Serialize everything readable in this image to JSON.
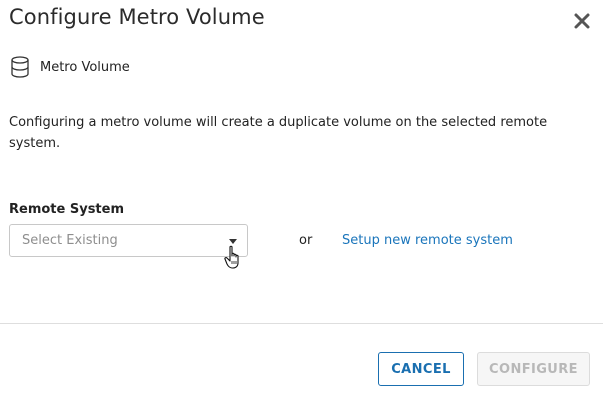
{
  "dialog": {
    "title": "Configure Metro Volume",
    "close_icon": "close-icon"
  },
  "volume": {
    "icon": "database-icon",
    "label": "Metro Volume"
  },
  "description": "Configuring a metro volume will create a duplicate volume on the selected remote system.",
  "remote_system": {
    "label": "Remote System",
    "select_placeholder": "Select Existing",
    "or_text": "or",
    "setup_link": "Setup new remote system"
  },
  "footer": {
    "cancel_label": "CANCEL",
    "configure_label": "CONFIGURE"
  },
  "colors": {
    "accent": "#1a75bb",
    "disabled_text": "#b8b8b8"
  }
}
